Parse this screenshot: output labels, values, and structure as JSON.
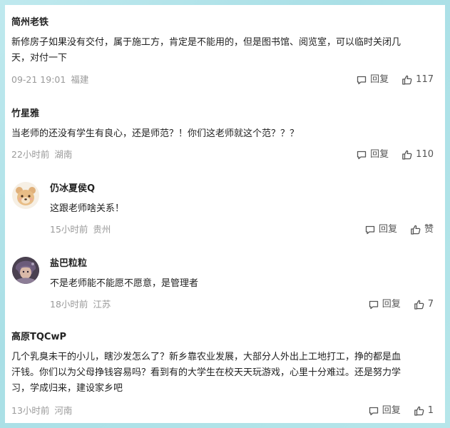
{
  "comments": [
    {
      "username": "简州老铁",
      "text_lines": [
        "新修房子如果没有交付，属于施工方，肯定是不能用的，但是图书馆、阅览室，可以临时关闭几",
        "天，对付一下"
      ],
      "time": "09-21 19:01",
      "location": "福建",
      "reply_label": "回复",
      "like_count": "117"
    },
    {
      "username": "竹星雅",
      "text_lines": [
        "当老师的还没有学生有良心，还是师范？！你们这老师就这个范？？？"
      ],
      "time": "22小时前",
      "location": "湖南",
      "reply_label": "回复",
      "like_count": "110"
    },
    {
      "username": "仍冰夏侯Q",
      "text_lines": [
        "这跟老师啥关系！"
      ],
      "time": "15小时前",
      "location": "贵州",
      "reply_label": "回复",
      "like_count": "赞",
      "avatar_icon": "bear-avatar-icon"
    },
    {
      "username": "盐巴粒粒",
      "text_lines": [
        "不是老师能不能愿不愿意，是管理者"
      ],
      "time": "18小时前",
      "location": "江苏",
      "reply_label": "回复",
      "like_count": "7",
      "avatar_icon": "character-avatar-icon"
    },
    {
      "username": "高原TQCwP",
      "text_lines": [
        "几个乳臭未干的小儿，瞎沙发怎么了？新乡靠农业发展，大部分人外出上工地打工，挣的都是血",
        "汗钱。你们以为父母挣钱容易吗？看到有的大学生在校天天玩游戏，心里十分难过。还是努力学",
        "习，学成归来，建设家乡吧"
      ],
      "time": "13小时前",
      "location": "河南",
      "reply_label": "回复",
      "like_count": "1"
    }
  ],
  "colors": {
    "username": "#222222",
    "meta": "#9a9a9a",
    "action": "#555555",
    "background_gradient": "#a9dfe6"
  }
}
